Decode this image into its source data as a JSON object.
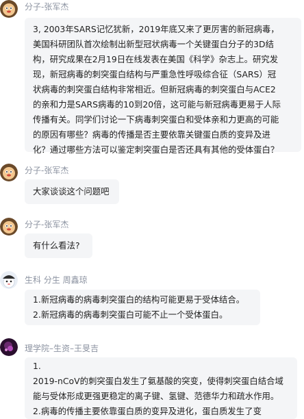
{
  "messages": [
    {
      "sender": "分子-张军杰",
      "lines": [
        "3,     2003年SARS记忆犹新，2019年底又来了更厉害的新冠病毒，",
        "美国科研团队首次绘制出新型冠状病毒一个关键蛋白分子的3D结",
        "构，研究成果在2月19日在线发表在美国《科学》杂志上。研究发",
        "现，新冠病毒的刺突蛋白结构与严重急性呼吸综合征（SARS）冠",
        "状病毒的刺突蛋白结构非常相近。但新冠病毒的刺突蛋白与ACE2",
        "的亲和力是SARS病毒的10到20倍，这可能与新冠病毒更易于人际",
        "传播有关。同学们讨论一下病毒刺突蛋白和受体亲和力更高的可能",
        "的原因有哪些？病毒的传播是否主要依靠关键蛋白质的变异及进",
        "化？通过哪些方法可以鉴定刺突蛋白是否还具有其他的受体蛋白？"
      ]
    },
    {
      "sender": "分子-张军杰",
      "lines": [
        "大家谈谈这个问题吧"
      ]
    },
    {
      "sender": "分子-张军杰",
      "lines": [
        "有什么看法?"
      ]
    },
    {
      "sender": "生科 分生 周鑫琼",
      "lines": [
        "1.新冠病毒的病毒刺突蛋白的结构可能更易于受体结合。",
        "2.新冠病毒的病毒刺突蛋白可能不止一个受体蛋白。"
      ]
    },
    {
      "sender": "理学院–生资–王旻吉",
      "lines": [
        "1.",
        "2019-nCoV的刺突蛋白发生了氨基酸的突变，使得刺突蛋白结合域",
        "能与受体形成更强更稳定的离子键、氢键、范德华力和疏水作用。",
        "2.病毒的传播主要依靠蛋白质的变异及进化，蛋白质发生了变"
      ]
    }
  ]
}
